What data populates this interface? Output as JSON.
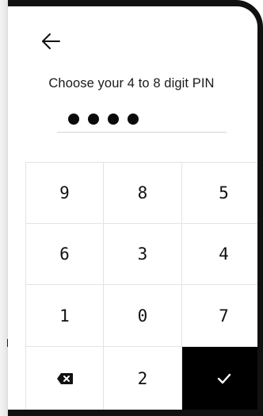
{
  "header": {
    "back_icon": "arrow-left-icon"
  },
  "title": "Choose your 4 to 8 digit PIN",
  "pin": {
    "entered_count": 4,
    "mask_char": "●"
  },
  "keypad": {
    "rows": [
      [
        "9",
        "8",
        "5"
      ],
      [
        "6",
        "3",
        "4"
      ],
      [
        "1",
        "0",
        "7"
      ]
    ],
    "last_row": {
      "backspace_icon": "backspace-icon",
      "digit": "2",
      "submit_icon": "checkmark-icon"
    }
  },
  "colors": {
    "submit_background": "#000000",
    "text": "#111111",
    "divider": "#e3e3e3"
  }
}
